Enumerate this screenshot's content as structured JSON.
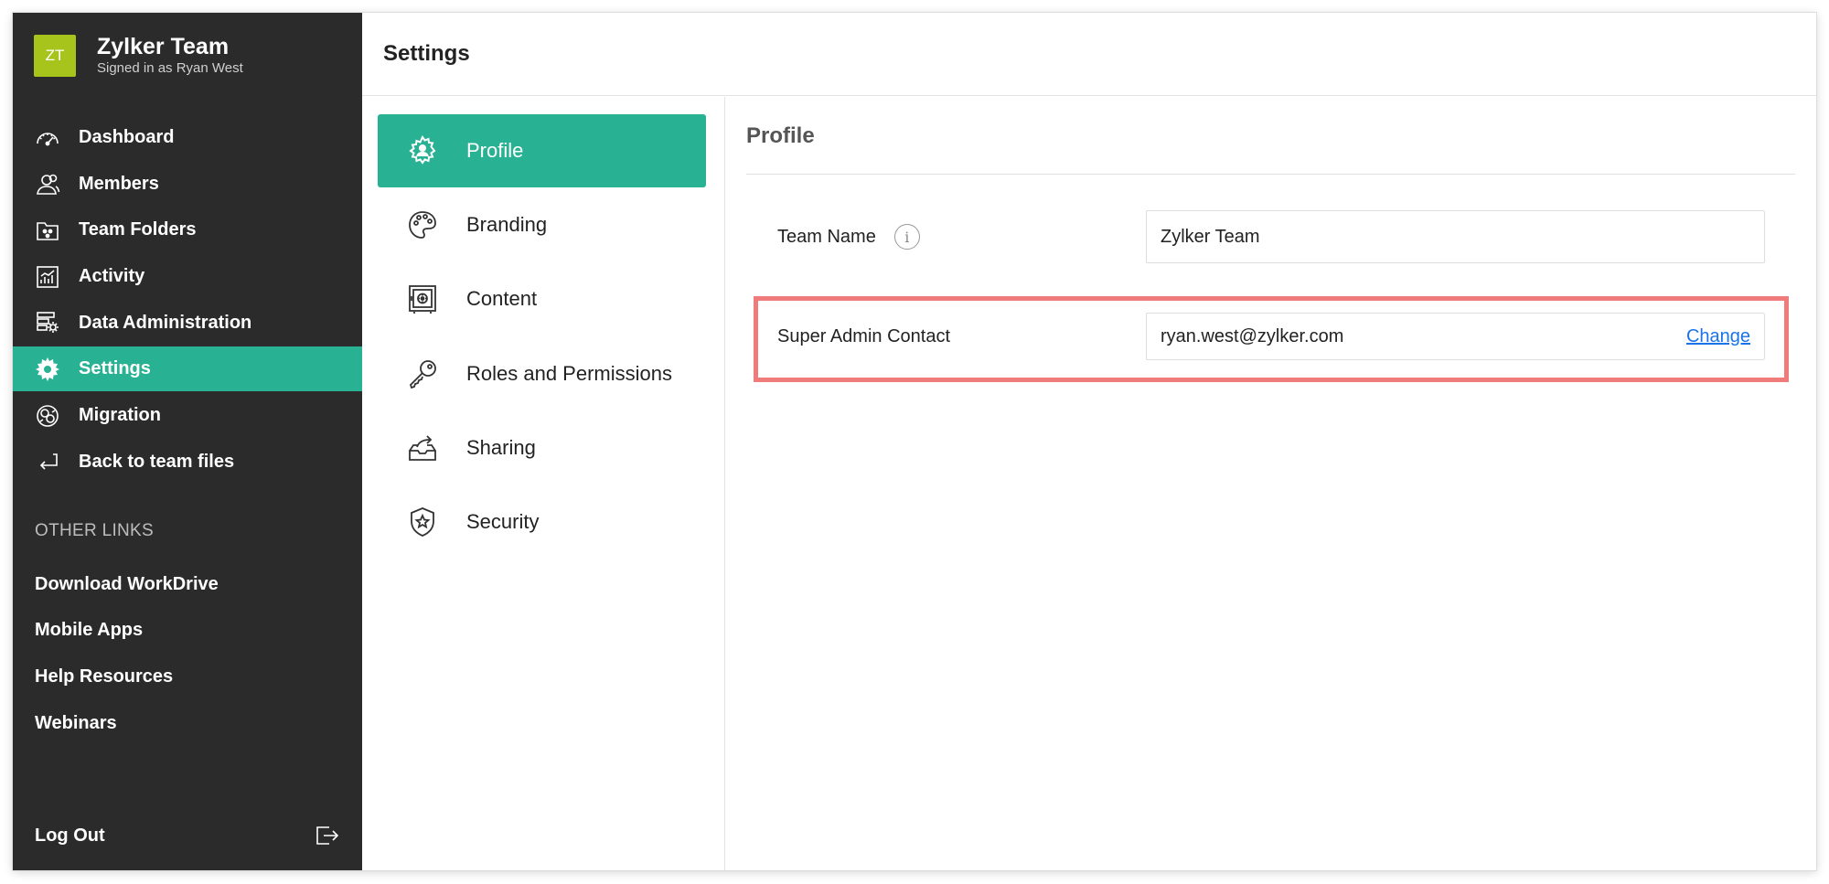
{
  "brand": {
    "initials": "ZT",
    "name": "Zylker Team",
    "signed_in": "Signed in as Ryan West",
    "avatar_color": "#a6c41c"
  },
  "sidebar": {
    "items": [
      {
        "label": "Dashboard",
        "icon": "gauge-icon"
      },
      {
        "label": "Members",
        "icon": "members-icon"
      },
      {
        "label": "Team Folders",
        "icon": "team-folder-icon"
      },
      {
        "label": "Activity",
        "icon": "activity-chart-icon"
      },
      {
        "label": "Data Administration",
        "icon": "data-admin-icon"
      },
      {
        "label": "Settings",
        "icon": "settings-gear-icon",
        "active": true
      },
      {
        "label": "Migration",
        "icon": "migration-icon"
      },
      {
        "label": "Back to team files",
        "icon": "back-arrow-icon"
      }
    ],
    "other_title": "OTHER LINKS",
    "other_links": [
      "Download WorkDrive",
      "Mobile Apps",
      "Help Resources",
      "Webinars"
    ],
    "logout_label": "Log Out"
  },
  "header": {
    "title": "Settings"
  },
  "settings_nav": {
    "items": [
      {
        "label": "Profile",
        "icon": "profile-gear-icon",
        "active": true
      },
      {
        "label": "Branding",
        "icon": "palette-icon"
      },
      {
        "label": "Content",
        "icon": "safe-icon"
      },
      {
        "label": "Roles and Permissions",
        "icon": "key-icon"
      },
      {
        "label": "Sharing",
        "icon": "share-tray-icon"
      },
      {
        "label": "Security",
        "icon": "shield-star-icon"
      }
    ]
  },
  "profile": {
    "title": "Profile",
    "team_name_label": "Team Name",
    "team_name_value": "Zylker Team",
    "super_admin_label": "Super Admin Contact",
    "super_admin_value": "ryan.west@zylker.com",
    "change_label": "Change"
  },
  "colors": {
    "sidebar_bg": "#2b2b2b",
    "accent": "#29b193",
    "highlight": "#f07b7b",
    "link": "#1a73e8"
  }
}
